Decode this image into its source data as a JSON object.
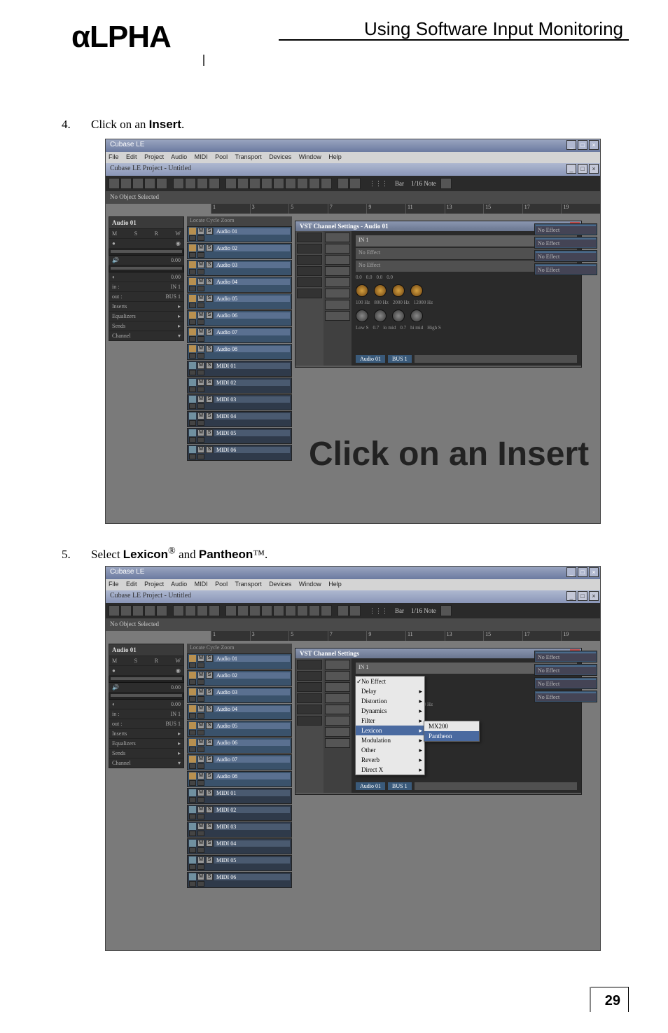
{
  "brand": "αLPHA",
  "header_title": "Using Software Input Monitoring",
  "page_number": "29",
  "steps": {
    "s1_num": "4.",
    "s1_pre": "Click on an ",
    "s1_bold": "Insert",
    "s1_post": ".",
    "s2_num": "5.",
    "s2_pre": "Select ",
    "s2_b1": "Lexicon",
    "s2_sup1": "®",
    "s2_mid": " and ",
    "s2_b2": "Pantheon",
    "s2_sup2": "™",
    "s2_post": "."
  },
  "app": {
    "title": "Cubase LE",
    "project_title": "Cubase LE Project - Untitled",
    "menu": [
      "File",
      "Edit",
      "Project",
      "Audio",
      "MIDI",
      "Pool",
      "Transport",
      "Devices",
      "Window",
      "Help"
    ],
    "no_object": "No Object Selected",
    "ruler": [
      "1",
      "3",
      "5",
      "7",
      "9",
      "11",
      "13",
      "15",
      "17",
      "19"
    ],
    "toolbar_labels": {
      "bar": "Bar",
      "note": "1/16 Note"
    }
  },
  "inspector": {
    "title": "Audio 01",
    "vol_val": "0.00",
    "pan_val": "0.00",
    "in_label": "in :",
    "in_val": "IN 1",
    "out_label": "out :",
    "out_val": "BUS 1",
    "inserts": "Inserts",
    "eq": "Equalizers",
    "sends": "Sends",
    "channel": "Channel"
  },
  "tracklist_head": "Locate  Cycle  Zoom",
  "tracks_audio": [
    "Audio 01",
    "Audio 02",
    "Audio 03",
    "Audio 04",
    "Audio 05",
    "Audio 06",
    "Audio 07",
    "Audio 08"
  ],
  "tracks_midi": [
    "MIDI 01",
    "MIDI 02",
    "MIDI 03",
    "MIDI 04",
    "MIDI 05",
    "MIDI 06"
  ],
  "vst": {
    "title": "VST Channel Settings - Audio 01",
    "title2": "VST Channel Settings",
    "in1": "IN 1",
    "noeff": "No Effect",
    "val0": "0.00",
    "eq_gain": [
      "0.0",
      "0.0",
      "0.0",
      "0.0"
    ],
    "eq_q": [
      "0.7",
      "0.7"
    ],
    "eq_freq": [
      "100 Hz",
      "800 Hz",
      "2000 Hz",
      "12000 Hz"
    ],
    "bands": [
      "Low S",
      "lo mid",
      "hi mid",
      "High S"
    ],
    "foot_track": "Audio 01",
    "foot_bus": "BUS 1"
  },
  "fxslots_labels": [
    "No Effect",
    "No Effect",
    "No Effect",
    "No Effect"
  ],
  "overlay_text": "Click on an Insert",
  "ctxmenu": {
    "items": [
      "No Effect",
      "Delay",
      "Distortion",
      "Dynamics",
      "Filter",
      "Lexicon",
      "Modulation",
      "Other",
      "Reverb",
      "Direct X"
    ],
    "flyout": [
      "MX200",
      "Pantheon"
    ]
  }
}
